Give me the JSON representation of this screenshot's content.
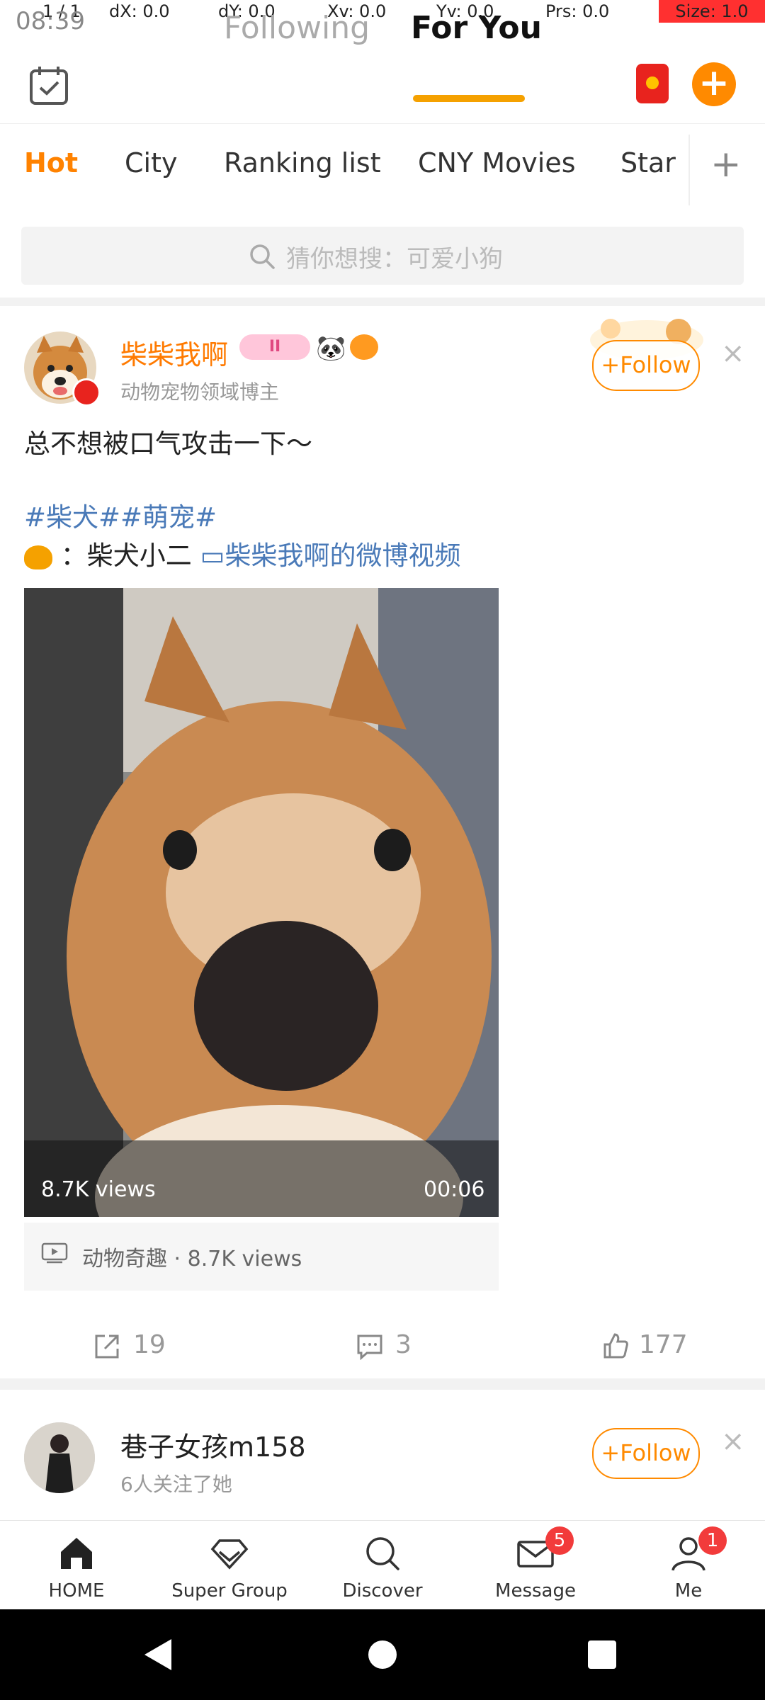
{
  "debug": {
    "pointer": "1 / 1",
    "dx": "dX: 0.0",
    "dy": "dY: 0.0",
    "xv": "Xv: 0.0",
    "yv": "Yv: 0.0",
    "prs": "Prs: 0.0",
    "size": "Size: 1.0"
  },
  "status": {
    "time": "08:39"
  },
  "top_bar": {
    "tabs": [
      {
        "label": "Following"
      },
      {
        "label": "For You"
      }
    ],
    "accent": "#f5a100"
  },
  "categories": [
    {
      "label": "Hot"
    },
    {
      "label": "City"
    },
    {
      "label": "Ranking list"
    },
    {
      "label": "CNY Movies"
    },
    {
      "label": "Star"
    }
  ],
  "category_add": "+",
  "search": {
    "placeholder": "猜你想搜：可爱小狗"
  },
  "post1": {
    "name": "柴柴我啊",
    "medal": "II",
    "subtitle": "动物宠物领域博主",
    "follow_label": "Follow",
    "close": "×",
    "text_line1": "总不想被口气攻击一下～",
    "hashtags": "#柴犬##萌宠#",
    "text_line3_prefix": "：柴犬小二",
    "video_link": "柴柴我啊的微博视频",
    "video": {
      "views": "8.7K views",
      "duration": "00:06"
    },
    "source": "动物奇趣 · 8.7K views",
    "actions": {
      "share_count": "19",
      "comment_count": "3",
      "like_count": "177"
    }
  },
  "post2": {
    "name": "巷子女孩m158",
    "subtitle": "6人关注了她",
    "follow_label": "Follow",
    "close": "×"
  },
  "bottom_nav": [
    {
      "label": "HOME",
      "icon": "home-icon"
    },
    {
      "label": "Super Group",
      "icon": "diamond-icon"
    },
    {
      "label": "Discover",
      "icon": "discover-icon"
    },
    {
      "label": "Message",
      "icon": "message-icon",
      "badge": "5"
    },
    {
      "label": "Me",
      "icon": "profile-icon",
      "badge": "1"
    }
  ],
  "colors": {
    "brand_orange": "#ff8a00",
    "link_blue": "#4a7ab8",
    "badge_red": "#f23b3b"
  }
}
